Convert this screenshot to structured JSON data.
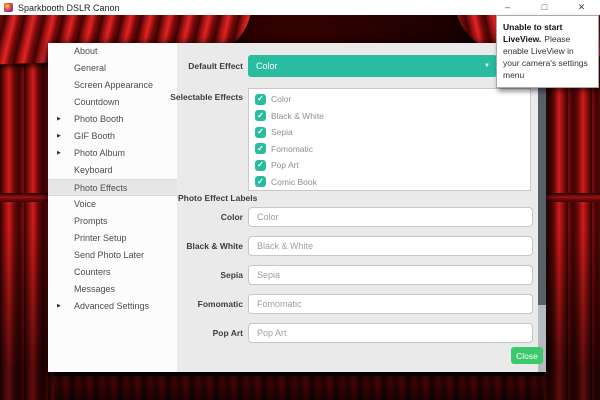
{
  "window": {
    "title": "Sparkbooth DSLR Canon"
  },
  "window_controls": {
    "minimize": "–",
    "maximize": "□",
    "close": "✕"
  },
  "icons": {
    "expand": "▶",
    "dropdown": "▼",
    "check": "✓"
  },
  "notification": {
    "title": "Unable to start LiveView.",
    "body": "Please enable LiveView in your camera's settings menu"
  },
  "sidebar": {
    "items": [
      {
        "label": "About",
        "expandable": false,
        "selected": false
      },
      {
        "label": "General",
        "expandable": false,
        "selected": false
      },
      {
        "label": "Screen Appearance",
        "expandable": false,
        "selected": false
      },
      {
        "label": "Countdown",
        "expandable": false,
        "selected": false
      },
      {
        "label": "Photo Booth",
        "expandable": true,
        "selected": false
      },
      {
        "label": "GIF Booth",
        "expandable": true,
        "selected": false
      },
      {
        "label": "Photo Album",
        "expandable": true,
        "selected": false
      },
      {
        "label": "Keyboard",
        "expandable": false,
        "selected": false
      },
      {
        "label": "Photo Effects",
        "expandable": false,
        "selected": true
      },
      {
        "label": "Voice",
        "expandable": false,
        "selected": false
      },
      {
        "label": "Prompts",
        "expandable": false,
        "selected": false
      },
      {
        "label": "Printer Setup",
        "expandable": false,
        "selected": false
      },
      {
        "label": "Send Photo Later",
        "expandable": false,
        "selected": false
      },
      {
        "label": "Counters",
        "expandable": false,
        "selected": false
      },
      {
        "label": "Messages",
        "expandable": false,
        "selected": false
      },
      {
        "label": "Advanced Settings",
        "expandable": true,
        "selected": false
      }
    ]
  },
  "content": {
    "default_effect_label": "Default Effect",
    "default_effect_value": "Color",
    "selectable_effects_label": "Selectable Effects",
    "effects": [
      {
        "label": "Color",
        "checked": true
      },
      {
        "label": "Black & White",
        "checked": true
      },
      {
        "label": "Sepia",
        "checked": true
      },
      {
        "label": "Fomomatic",
        "checked": true
      },
      {
        "label": "Pop Art",
        "checked": true
      },
      {
        "label": "Comic Book",
        "checked": true
      }
    ],
    "labels_heading": "Photo Effect Labels",
    "label_fields": [
      {
        "name": "Color",
        "value": "Color"
      },
      {
        "name": "Black & White",
        "value": "Black & White"
      },
      {
        "name": "Sepia",
        "value": "Sepia"
      },
      {
        "name": "Fomomatic",
        "value": "Fomomatic"
      },
      {
        "name": "Pop Art",
        "value": "Pop Art"
      }
    ],
    "close_button": "Close"
  },
  "colors": {
    "accent_teal": "#2abca0",
    "close_green": "#3bc96d",
    "curtain_red": "#a81414"
  }
}
